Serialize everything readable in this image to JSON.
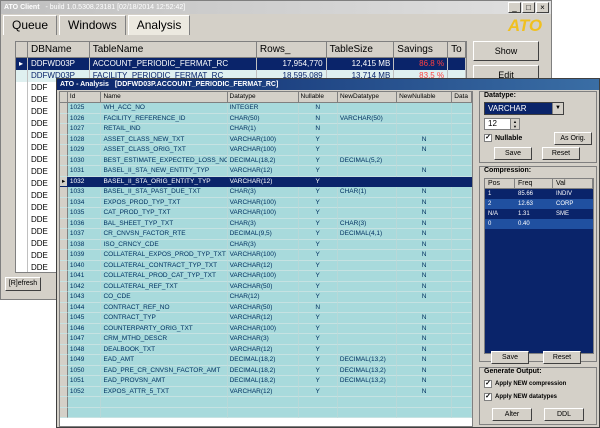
{
  "bg_window": {
    "title_app": "ATO Client",
    "title_build": "- build 1.0.5308.23181 [02/18/2014 12:52:42]",
    "tabs": [
      "Queue",
      "Windows",
      "Analysis"
    ],
    "logo_text": "ATO",
    "columns": [
      "DBName",
      "TableName",
      "Rows_",
      "TableSize",
      "Savings",
      "To"
    ],
    "rows": [
      {
        "db": "DDFWD03P",
        "table": "ACCOUNT_PERIODIC_FERMAT_RC",
        "rows": "17,954,770",
        "size": "12,415 MB",
        "savings": "86.8 %"
      },
      {
        "db": "DDFWD03P",
        "table": "FACILITY_PERIODIC_FERMAT_RC",
        "rows": "18,595,089",
        "size": "13,714 MB",
        "savings": "83.5 %"
      },
      {
        "db": "DDF",
        "table": "",
        "rows": "",
        "size": "",
        "savings": ""
      },
      {
        "db": "DDE",
        "table": "",
        "rows": "",
        "size": "",
        "savings": ""
      },
      {
        "db": "DDE",
        "table": "",
        "rows": "",
        "size": "",
        "savings": ""
      },
      {
        "db": "DDE",
        "table": "",
        "rows": "",
        "size": "",
        "savings": ""
      },
      {
        "db": "DDE",
        "table": "",
        "rows": "",
        "size": "",
        "savings": ""
      },
      {
        "db": "DDE",
        "table": "",
        "rows": "",
        "size": "",
        "savings": ""
      },
      {
        "db": "DDE",
        "table": "",
        "rows": "",
        "size": "",
        "savings": ""
      },
      {
        "db": "DDE",
        "table": "",
        "rows": "",
        "size": "",
        "savings": ""
      },
      {
        "db": "DDE",
        "table": "",
        "rows": "",
        "size": "",
        "savings": ""
      },
      {
        "db": "DDE",
        "table": "",
        "rows": "",
        "size": "",
        "savings": ""
      },
      {
        "db": "DDE",
        "table": "",
        "rows": "",
        "size": "",
        "savings": ""
      },
      {
        "db": "DDE",
        "table": "",
        "rows": "",
        "size": "",
        "savings": ""
      },
      {
        "db": "DDE",
        "table": "",
        "rows": "",
        "size": "",
        "savings": ""
      },
      {
        "db": "DDE",
        "table": "",
        "rows": "",
        "size": "",
        "savings": ""
      },
      {
        "db": "DDE",
        "table": "",
        "rows": "",
        "size": "",
        "savings": ""
      },
      {
        "db": "DDE",
        "table": "",
        "rows": "",
        "size": "",
        "savings": ""
      }
    ],
    "show_button": "Show",
    "edit_button": "Edit",
    "refresh_button": "[R]efresh"
  },
  "fg_window": {
    "title_app": "ATO - Analysis",
    "title_ctx": "[DDFWD03P.ACCOUNT_PERIODIC_FERMAT_RC]",
    "columns": [
      "Id",
      "Name",
      "Datatype",
      "Nullable",
      "NewDatatype",
      "NewNullable",
      "Data"
    ],
    "rows": [
      {
        "id": "1025",
        "name": "WH_ACC_NO",
        "dt": "INTEGER",
        "nul": "N",
        "ndt": "",
        "nnul": ""
      },
      {
        "id": "1026",
        "name": "FACILITY_REFERENCE_ID",
        "dt": "CHAR(50)",
        "nul": "N",
        "ndt": "VARCHAR(50)",
        "nnul": ""
      },
      {
        "id": "1027",
        "name": "RETAIL_IND",
        "dt": "CHAR(1)",
        "nul": "N",
        "ndt": "",
        "nnul": ""
      },
      {
        "id": "1028",
        "name": "ASSET_CLASS_NEW_TXT",
        "dt": "VARCHAR(100)",
        "nul": "Y",
        "ndt": "",
        "nnul": "N"
      },
      {
        "id": "1029",
        "name": "ASSET_CLASS_ORIG_TXT",
        "dt": "VARCHAR(100)",
        "nul": "Y",
        "ndt": "",
        "nnul": "N"
      },
      {
        "id": "1030",
        "name": "BEST_ESTIMATE_EXPECTED_LOSS_NO",
        "dt": "DECIMAL(18,2)",
        "nul": "Y",
        "ndt": "DECIMAL(5,2)",
        "nnul": ""
      },
      {
        "id": "1031",
        "name": "BASEL_II_STA_NEW_ENTITY_TYP",
        "dt": "VARCHAR(12)",
        "nul": "Y",
        "ndt": "",
        "nnul": "N"
      },
      {
        "id": "1032",
        "name": "BASEL_II_STA_ORIG_ENTITY_TYP",
        "dt": "VARCHAR(12)",
        "nul": "Y",
        "ndt": "",
        "nnul": "",
        "sel": true
      },
      {
        "id": "1033",
        "name": "BASEL_II_STA_PAST_DUE_TXT",
        "dt": "CHAR(3)",
        "nul": "Y",
        "ndt": "CHAR(1)",
        "nnul": "N"
      },
      {
        "id": "1034",
        "name": "EXPOS_PROD_TYP_TXT",
        "dt": "VARCHAR(100)",
        "nul": "Y",
        "ndt": "",
        "nnul": "N"
      },
      {
        "id": "1035",
        "name": "CAT_PROD_TYP_TXT",
        "dt": "VARCHAR(100)",
        "nul": "Y",
        "ndt": "",
        "nnul": "N"
      },
      {
        "id": "1036",
        "name": "BAL_SHEET_TYP_TXT",
        "dt": "CHAR(3)",
        "nul": "Y",
        "ndt": "CHAR(3)",
        "nnul": "N"
      },
      {
        "id": "1037",
        "name": "CR_CNVSN_FACTOR_RTE",
        "dt": "DECIMAL(9,5)",
        "nul": "Y",
        "ndt": "DECIMAL(4,1)",
        "nnul": "N"
      },
      {
        "id": "1038",
        "name": "ISO_CRNCY_CDE",
        "dt": "CHAR(3)",
        "nul": "Y",
        "ndt": "",
        "nnul": "N"
      },
      {
        "id": "1039",
        "name": "COLLATERAL_EXPOS_PROD_TYP_TXT",
        "dt": "VARCHAR(100)",
        "nul": "Y",
        "ndt": "",
        "nnul": "N"
      },
      {
        "id": "1040",
        "name": "COLLATERAL_CONTRACT_TYP_TXT",
        "dt": "VARCHAR(12)",
        "nul": "Y",
        "ndt": "",
        "nnul": "N"
      },
      {
        "id": "1041",
        "name": "COLLATERAL_PROD_CAT_TYP_TXT",
        "dt": "VARCHAR(100)",
        "nul": "Y",
        "ndt": "",
        "nnul": "N"
      },
      {
        "id": "1042",
        "name": "COLLATERAL_REF_TXT",
        "dt": "VARCHAR(50)",
        "nul": "Y",
        "ndt": "",
        "nnul": "N"
      },
      {
        "id": "1043",
        "name": "CO_CDE",
        "dt": "CHAR(12)",
        "nul": "Y",
        "ndt": "",
        "nnul": "N"
      },
      {
        "id": "1044",
        "name": "CONTRACT_REF_NO",
        "dt": "VARCHAR(50)",
        "nul": "N",
        "ndt": "",
        "nnul": ""
      },
      {
        "id": "1045",
        "name": "CONTRACT_TYP",
        "dt": "VARCHAR(12)",
        "nul": "Y",
        "ndt": "",
        "nnul": "N"
      },
      {
        "id": "1046",
        "name": "COUNTERPARTY_ORIG_TXT",
        "dt": "VARCHAR(100)",
        "nul": "Y",
        "ndt": "",
        "nnul": "N"
      },
      {
        "id": "1047",
        "name": "CRM_MTHD_DESCR",
        "dt": "VARCHAR(3)",
        "nul": "Y",
        "ndt": "",
        "nnul": "N"
      },
      {
        "id": "1048",
        "name": "DEALBOOK_TXT",
        "dt": "VARCHAR(12)",
        "nul": "Y",
        "ndt": "",
        "nnul": "N"
      },
      {
        "id": "1049",
        "name": "EAD_AMT",
        "dt": "DECIMAL(18,2)",
        "nul": "Y",
        "ndt": "DECIMAL(13,2)",
        "nnul": "N"
      },
      {
        "id": "1050",
        "name": "EAD_PRE_CR_CNVSN_FACTOR_AMT",
        "dt": "DECIMAL(18,2)",
        "nul": "Y",
        "ndt": "DECIMAL(13,2)",
        "nnul": "N"
      },
      {
        "id": "1051",
        "name": "EAD_PROVSN_AMT",
        "dt": "DECIMAL(18,2)",
        "nul": "Y",
        "ndt": "DECIMAL(13,2)",
        "nnul": "N"
      },
      {
        "id": "1052",
        "name": "EXPOS_ATTR_5_TXT",
        "dt": "VARCHAR(12)",
        "nul": "Y",
        "ndt": "",
        "nnul": "N"
      },
      {
        "id": "",
        "name": "",
        "dt": "",
        "nul": "",
        "ndt": "",
        "nnul": ""
      },
      {
        "id": "",
        "name": "",
        "dt": "",
        "nul": "",
        "ndt": "",
        "nnul": ""
      }
    ],
    "datatype": {
      "label": "Datatype:",
      "value": "VARCHAR",
      "length": "12",
      "nullable_label": "Nullable",
      "as_orig_button": "As Orig.",
      "save_button": "Save",
      "reset_button": "Reset"
    },
    "compression": {
      "label": "Compression:",
      "columns": [
        "Pos",
        "Freq",
        "Val"
      ],
      "rows": [
        {
          "pos": "1",
          "freq": "85.66",
          "val": "INDIV"
        },
        {
          "pos": "2",
          "freq": "12.63",
          "val": "CORP"
        },
        {
          "pos": "N/A",
          "freq": "1.31",
          "val": "SME"
        },
        {
          "pos": "0",
          "freq": "0.40",
          "val": ""
        }
      ],
      "save_button": "Save",
      "reset_button": "Reset"
    },
    "generate": {
      "label": "Generate Output:",
      "apply_compression": "Apply NEW compression",
      "apply_datatypes": "Apply NEW datatypes",
      "alter_button": "Alter",
      "ddl_button": "DDL"
    }
  },
  "colors": {
    "selection": "#0a246a",
    "grid_cell": "#a8dadc",
    "savings_red": "#ff4040",
    "logo": "#f0c020"
  }
}
